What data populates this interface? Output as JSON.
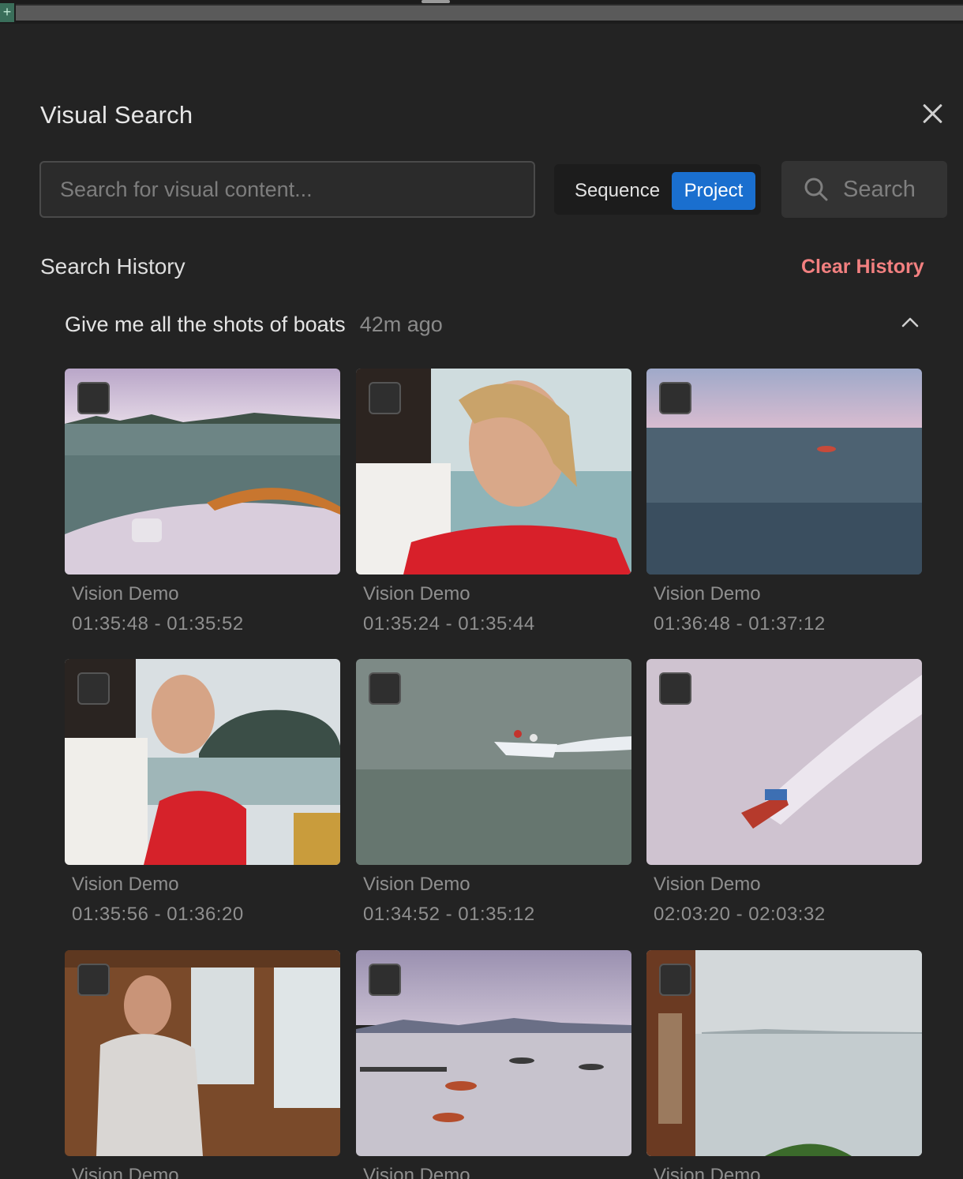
{
  "panel": {
    "title": "Visual Search",
    "close_icon": "close-icon"
  },
  "search": {
    "placeholder": "Search for visual content...",
    "value": "",
    "scope_options": [
      "Sequence",
      "Project"
    ],
    "scope_selected": "Project",
    "button_label": "Search",
    "button_icon": "search-icon"
  },
  "history": {
    "title": "Search History",
    "clear_label": "Clear History",
    "groups": [
      {
        "query": "Give me all the shots of boats",
        "ago": "42m ago",
        "expanded": true,
        "results": [
          {
            "name": "Vision Demo",
            "range": "01:35:48 - 01:35:52",
            "thumbnail": "boat bow on sea"
          },
          {
            "name": "Vision Demo",
            "range": "01:35:24 - 01:35:44",
            "thumbnail": "couple on boat"
          },
          {
            "name": "Vision Demo",
            "range": "01:36:48 - 01:37:12",
            "thumbnail": "distant boat on sea"
          },
          {
            "name": "Vision Demo",
            "range": "01:35:56 - 01:36:20",
            "thumbnail": "couple kissing on boat"
          },
          {
            "name": "Vision Demo",
            "range": "01:34:52 - 01:35:12",
            "thumbnail": "speedboat on water"
          },
          {
            "name": "Vision Demo",
            "range": "02:03:20 - 02:03:32",
            "thumbnail": "longtail boat wake"
          },
          {
            "name": "Vision Demo",
            "range": "",
            "thumbnail": "woman seated in boat cabin"
          },
          {
            "name": "Vision Demo",
            "range": "",
            "thumbnail": "boats in bay"
          },
          {
            "name": "Vision Demo",
            "range": "",
            "thumbnail": "sea view from balcony"
          }
        ]
      }
    ]
  },
  "colors": {
    "background": "#232323",
    "accent": "#1a6fcf",
    "clear_history": "#f28080"
  }
}
